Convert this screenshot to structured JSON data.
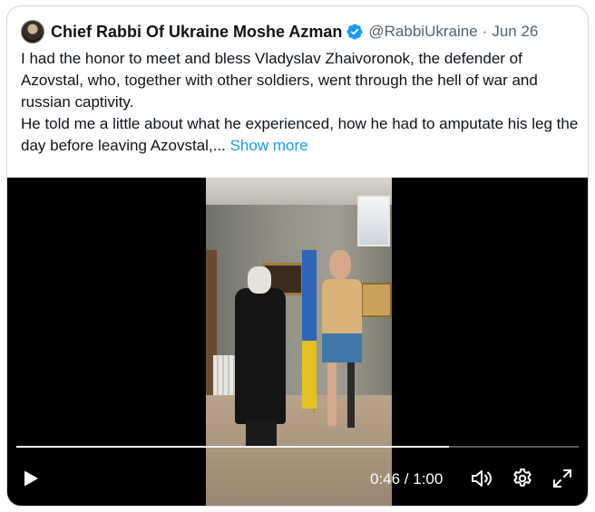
{
  "tweet": {
    "author_name": "Chief Rabbi Of Ukraine Moshe Azman",
    "handle": "@RabbiUkraine",
    "separator": "·",
    "date": "Jun 26",
    "text_line1": "I had the honor to meet and bless Vladyslav Zhaivoronok, the defender of Azovstal, who, together with other soldiers, went through the hell of war and russian captivity.",
    "text_line2": "He told me a little about what he experienced, how he had to amputate his leg the day before leaving Azovstal,...",
    "show_more": "Show more"
  },
  "video": {
    "current_time": "0:46",
    "duration": "1:00",
    "time_display": "0:46 / 1:00",
    "progress": 0.77
  },
  "colors": {
    "link": "#1d9bf0",
    "verified_badge": "#1d9bf0",
    "secondary_text": "#536471"
  },
  "icons": {
    "avatar": "avatar",
    "verified": "verified-badge-icon",
    "play": "play-icon",
    "volume": "volume-icon",
    "settings": "settings-gear-icon",
    "fullscreen": "fullscreen-icon"
  }
}
